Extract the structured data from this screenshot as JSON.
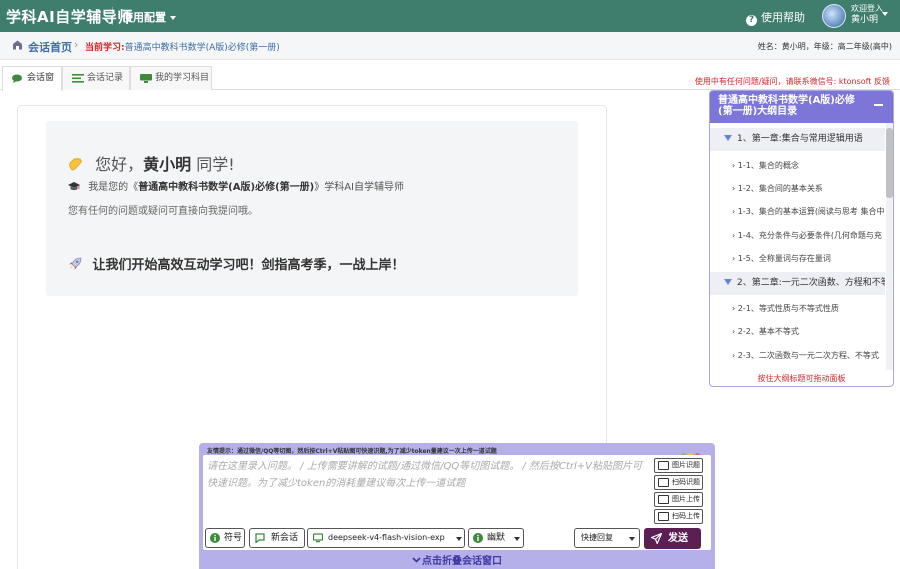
{
  "header": {
    "brand": "学科AI自学辅导师",
    "config_menu": "使用配置",
    "help": "使用帮助",
    "user": {
      "welcome": "欢迎登入",
      "name": "黄小明"
    }
  },
  "breadcrumb": {
    "home": "会话首页",
    "separator": "›",
    "current_label": "当前学习:",
    "current_subject": "普通高中教科书数学(A版)必修(第一册)",
    "student_info": "姓名：黄小明，年级：高二年级(高中)"
  },
  "tabs": [
    {
      "label": "会话窗",
      "active": true
    },
    {
      "label": "会话记录",
      "active": false
    },
    {
      "label": "我的学习科目",
      "active": false
    }
  ],
  "notice": "使用中有任何问题/疑问，请联系微信号: ktonsoft 反馈",
  "welcome": {
    "greeting_prefix": "您好，",
    "greeting_name": "黄小明",
    "greeting_suffix": " 同学!",
    "intro_prefix": "我是您的《",
    "intro_book": "普通高中教科书数学(A版)必修(第一册)",
    "intro_suffix": "》学科AI自学辅导师",
    "ask": "您有任何的问题或疑问可直接向我提问哦。",
    "slogan": "让我们开始高效互动学习吧！剑指高考季，一战上岸！"
  },
  "outline": {
    "title": "普通高中教科书数学(A版)必修(第一册)大纲目录",
    "footer": "按住大纲标题可拖动面板",
    "chapters": [
      {
        "label": "1、第一章:集合与常用逻辑用语",
        "sections": [
          "1-1、集合的概念",
          "1-2、集合间的基本关系",
          "1-3、集合的基本运算(阅读与思考 集合中",
          "1-4、充分条件与必要条件(几何命题与充",
          "1-5、全称量词与存在量词"
        ]
      },
      {
        "label": "2、第二章:一元二次函数、方程和不等",
        "sections": [
          "2-1、等式性质与不等式性质",
          "2-2、基本不等式",
          "2-3、二次函数与一元二次方程、不等式"
        ]
      }
    ]
  },
  "input": {
    "tip": "友情提示：通过微信/QQ等切图，然后按Ctrl+V粘贴图可快速识题,为了减少token量建议一次上传一道试题",
    "placeholder": "请在这里录入问题。 / 上传需要讲解的试题/通过微信/QQ等切图试题。 / 然后按Ctrl+V粘贴图片可快速识题。为了减少token的消耗量建议每次上传一道试题",
    "side_buttons": [
      "图片识题",
      "扫码识题",
      "图片上传",
      "扫码上传"
    ],
    "symbol_btn": "符号",
    "new_chat_btn": "新会话",
    "model": "deepseek-v4-flash-vision-exp",
    "style": "幽默",
    "quick_reply": "快捷回复",
    "send": "发送",
    "collapse": "点击折叠会话窗口"
  },
  "colors": {
    "topbar": "#3f7d6c",
    "accent_red": "#d3272e",
    "outline_header": "#7b76d8",
    "input_panel": "#b6b0ea",
    "send_button": "#5b1f56"
  }
}
